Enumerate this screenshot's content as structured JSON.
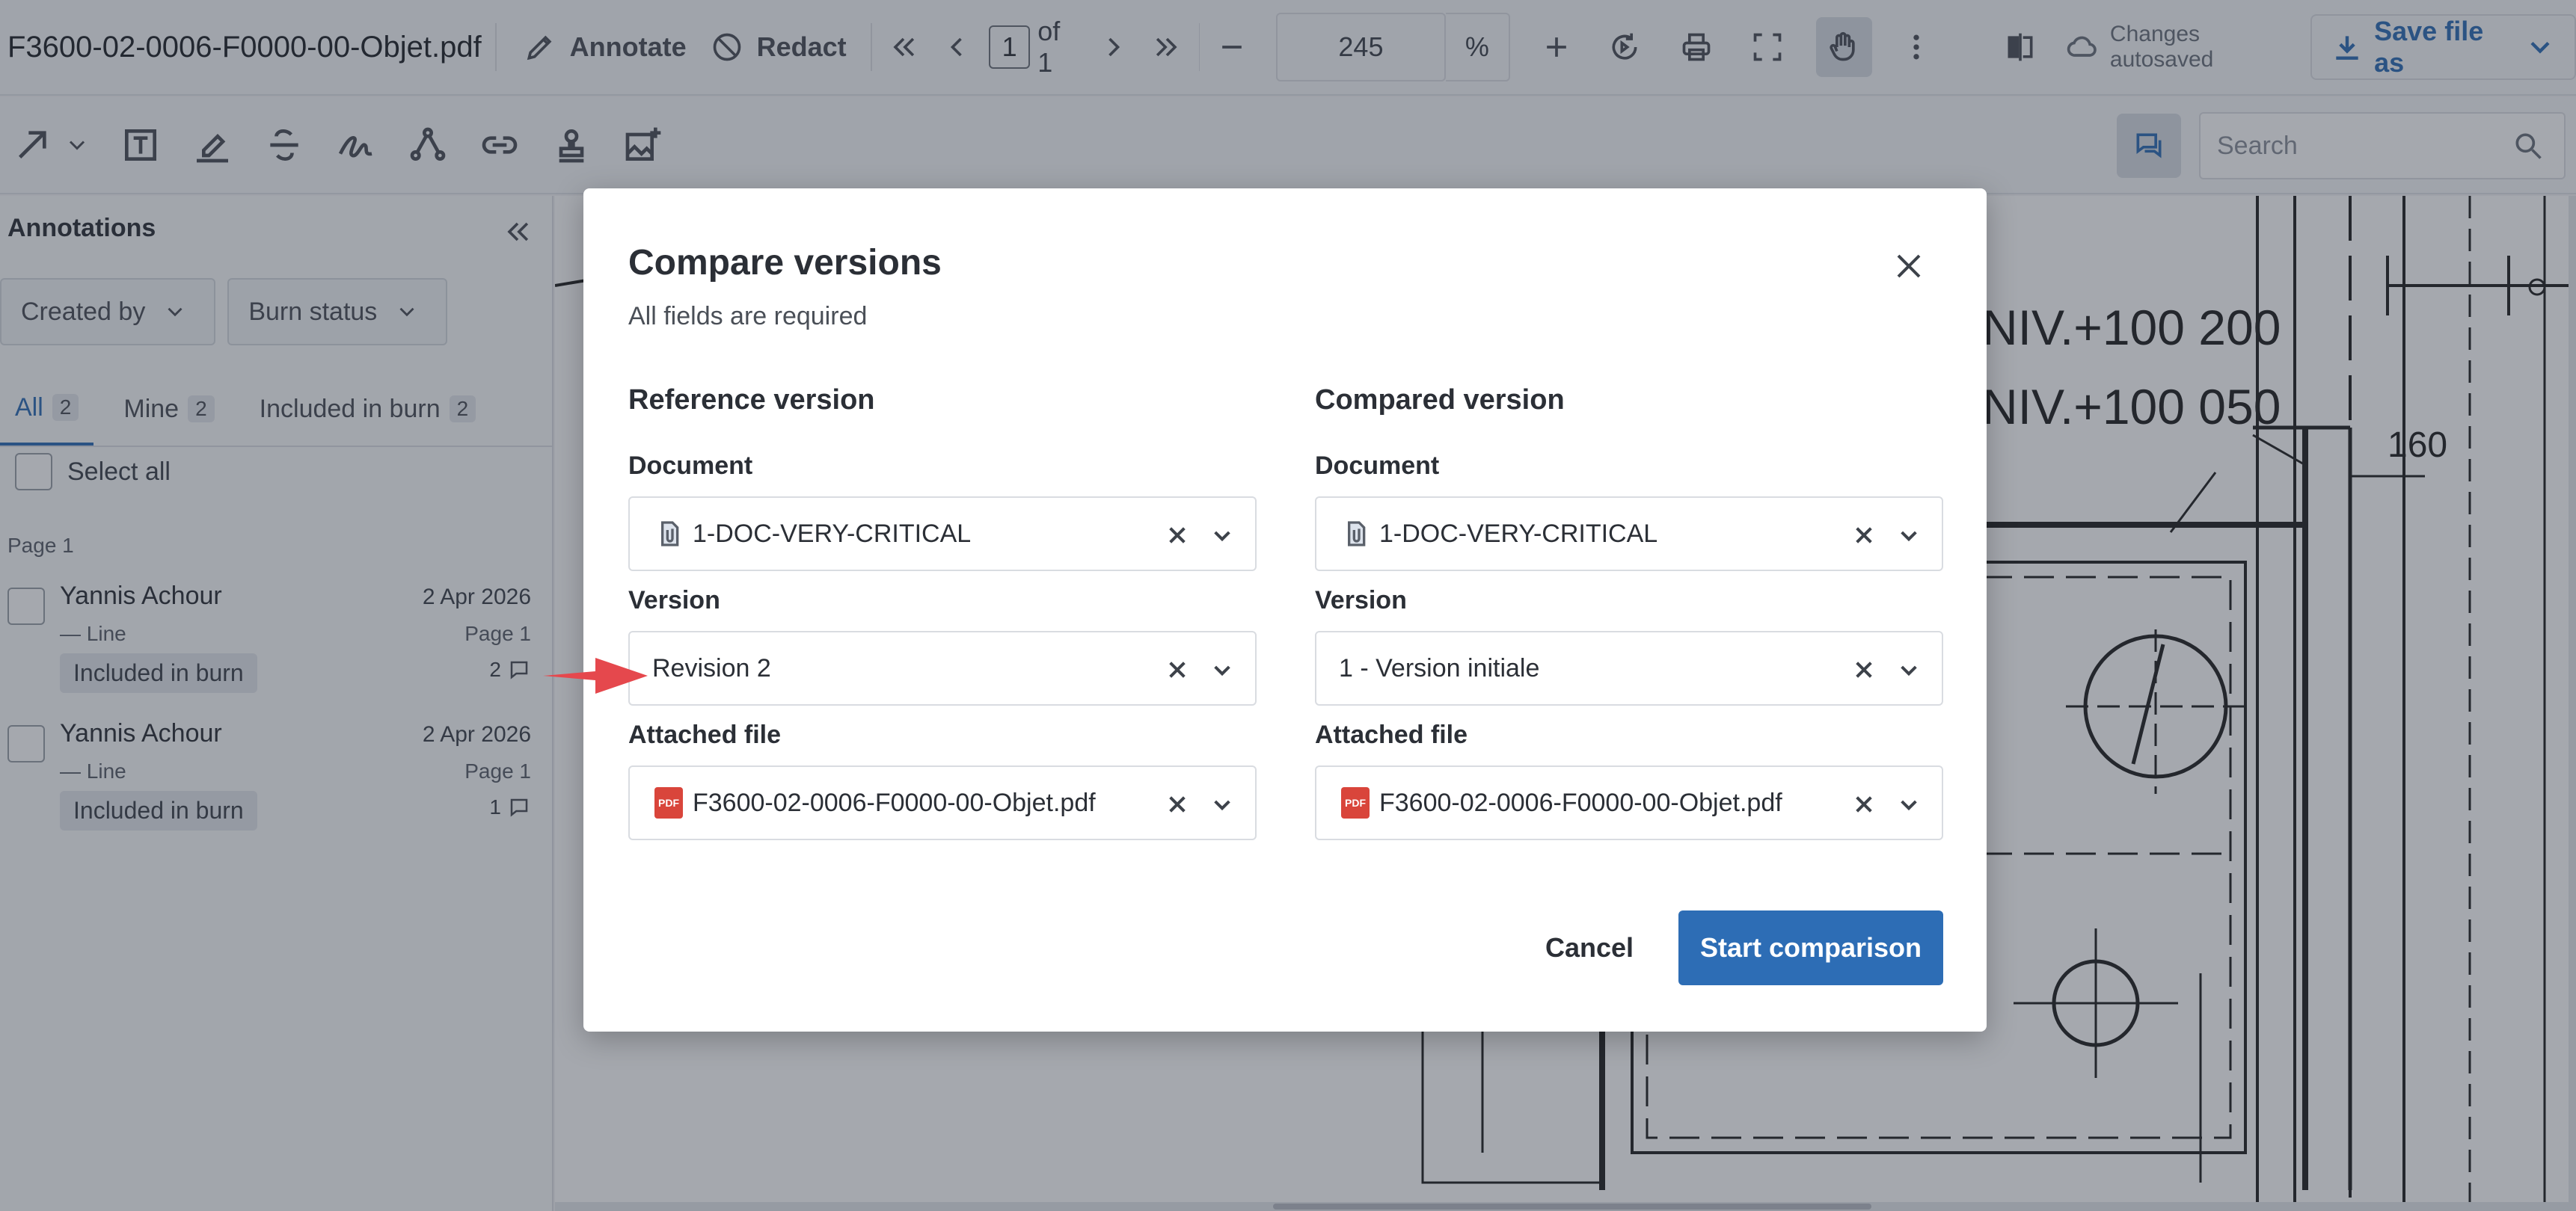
{
  "toolbar": {
    "file_name": "F3600-02-0006-F0000-00-Objet.pdf",
    "annotate_label": "Annotate",
    "redact_label": "Redact",
    "page_current": "1",
    "page_of": "of 1",
    "zoom_value": "245",
    "zoom_unit": "%",
    "autosave_status": "Changes autosaved",
    "save_label": "Save file as"
  },
  "search": {
    "placeholder": "Search"
  },
  "sidebar": {
    "title": "Annotations",
    "filters": [
      "Created by",
      "Burn status"
    ],
    "tabs": [
      {
        "label": "All",
        "count": "2"
      },
      {
        "label": "Mine",
        "count": "2"
      },
      {
        "label": "Included in burn",
        "count": "2"
      }
    ],
    "select_all": "Select all",
    "page_label": "Page 1",
    "annotations": [
      {
        "author": "Yannis Achour",
        "date": "2 Apr 2026",
        "type": "— Line",
        "page": "Page 1",
        "status": "Included in burn",
        "replies": "2"
      },
      {
        "author": "Yannis Achour",
        "date": "2 Apr 2026",
        "type": "— Line",
        "page": "Page 1",
        "status": "Included in burn",
        "replies": "1"
      }
    ]
  },
  "drawing": {
    "labels": [
      "NIV.+100  200",
      "NIV.+100  050",
      "160"
    ]
  },
  "modal": {
    "title": "Compare versions",
    "subtitle": "All fields are required",
    "reference": {
      "heading": "Reference version",
      "document_label": "Document",
      "document_value": "1-DOC-VERY-CRITICAL",
      "version_label": "Version",
      "version_value": "Revision 2",
      "file_label": "Attached file",
      "file_value": "F3600-02-0006-F0000-00-Objet.pdf"
    },
    "compared": {
      "heading": "Compared version",
      "document_label": "Document",
      "document_value": "1-DOC-VERY-CRITICAL",
      "version_label": "Version",
      "version_value": "1 - Version initiale",
      "file_label": "Attached file",
      "file_value": "F3600-02-0006-F0000-00-Objet.pdf"
    },
    "cancel_label": "Cancel",
    "start_label": "Start comparison",
    "pdf_badge": "PDF"
  },
  "colors": {
    "accent": "#2d6db5",
    "pointer_arrow": "#e5484d",
    "pdf_icon": "#d9453b"
  }
}
